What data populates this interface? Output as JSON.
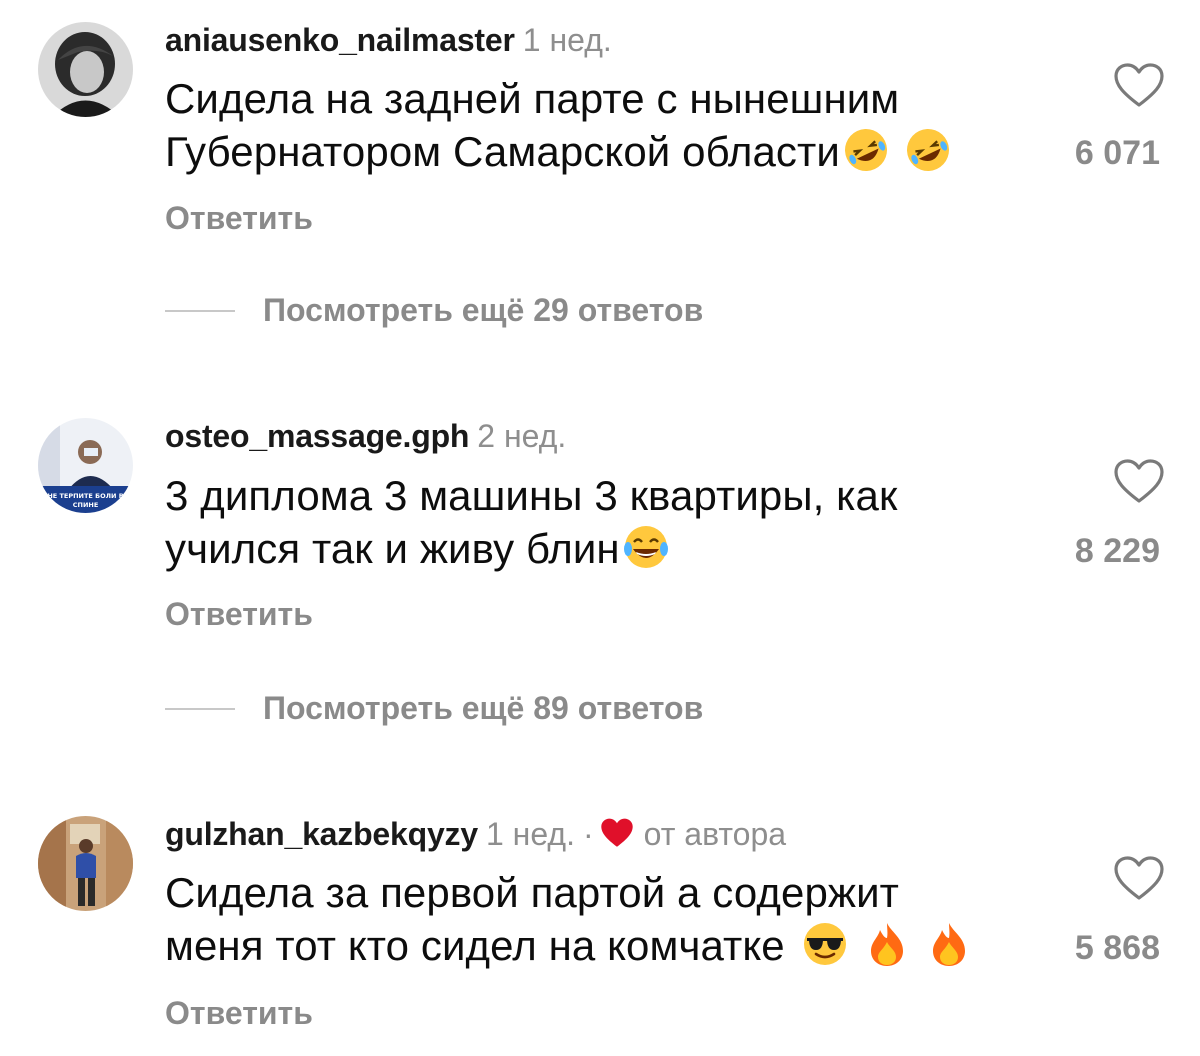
{
  "comments": [
    {
      "username": "aniausenko_nailmaster",
      "time": "1 нед.",
      "text_line1": "Сидела на задней парте с нынешним",
      "text_line2": "Губернатором Самарской области",
      "text_emojis": [
        "rofl-emoji",
        "rofl-emoji"
      ],
      "reply_label": "Ответить",
      "likes": "6 071",
      "more_replies": "Посмотреть ещё 29 ответов"
    },
    {
      "username": "osteo_massage.gph",
      "time": "2 нед.",
      "text_line1": "3 диплома 3 машины 3 квартиры, как",
      "text_line2": "учился так и живу блин",
      "text_emojis": [
        "tears-of-joy-emoji"
      ],
      "avatar_caption": "НЕ ТЕРПИТЕ БОЛИ В СПИНЕ",
      "reply_label": "Ответить",
      "likes": "8 229",
      "more_replies": "Посмотреть ещё 89 ответов"
    },
    {
      "username": "gulzhan_kazbekqyzy",
      "time": "1 нед.",
      "separator": "·",
      "author_badge": "от автора",
      "text_line1": "Сидела за первой партой а содержит",
      "text_line2": "меня тот кто сидел на комчатке",
      "text_emojis": [
        "sunglasses-emoji",
        "fire-emoji",
        "fire-emoji"
      ],
      "reply_label": "Ответить",
      "likes": "5 868"
    }
  ],
  "colors": {
    "text": "#0d0d0d",
    "muted": "#8a8a8a",
    "author_heart": "#e0102a"
  }
}
